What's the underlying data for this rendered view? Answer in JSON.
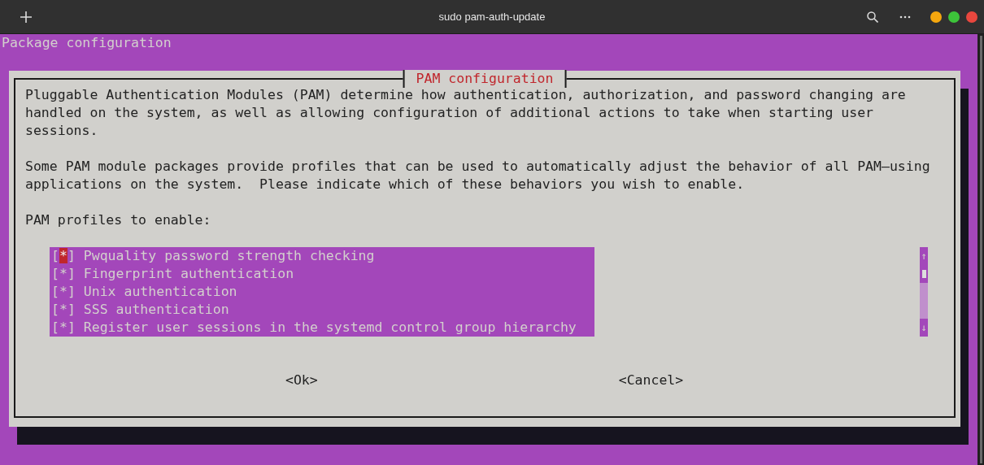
{
  "window": {
    "title": "sudo pam-auth-update"
  },
  "terminal": {
    "header": "Package configuration",
    "dialog": {
      "title": "PAM configuration",
      "paragraphs": [
        "Pluggable Authentication Modules (PAM) determine how authentication, authorization, and password changing are handled on the system, as well as allowing configuration of additional actions to take when starting user sessions.",
        "Some PAM module packages provide profiles that can be used to automatically adjust the behavior of all PAM–using applications on the system.  Please indicate which of these behaviors you wish to enable."
      ],
      "prompt": "PAM profiles to enable:",
      "checklist": {
        "box_left": "[",
        "box_right": "]",
        "check_mark": "*",
        "items": [
          {
            "label": "Pwquality password strength checking",
            "checked": true,
            "selected": true
          },
          {
            "label": "Fingerprint authentication",
            "checked": true,
            "selected": false
          },
          {
            "label": "Unix authentication",
            "checked": true,
            "selected": false
          },
          {
            "label": "SSS authentication",
            "checked": true,
            "selected": false
          },
          {
            "label": "Register user sessions in the systemd control group hierarchy",
            "checked": true,
            "selected": false
          }
        ],
        "scroll": {
          "up": "↑",
          "down": "↓"
        }
      },
      "buttons": [
        "<Ok>",
        "<Cancel>"
      ]
    }
  }
}
